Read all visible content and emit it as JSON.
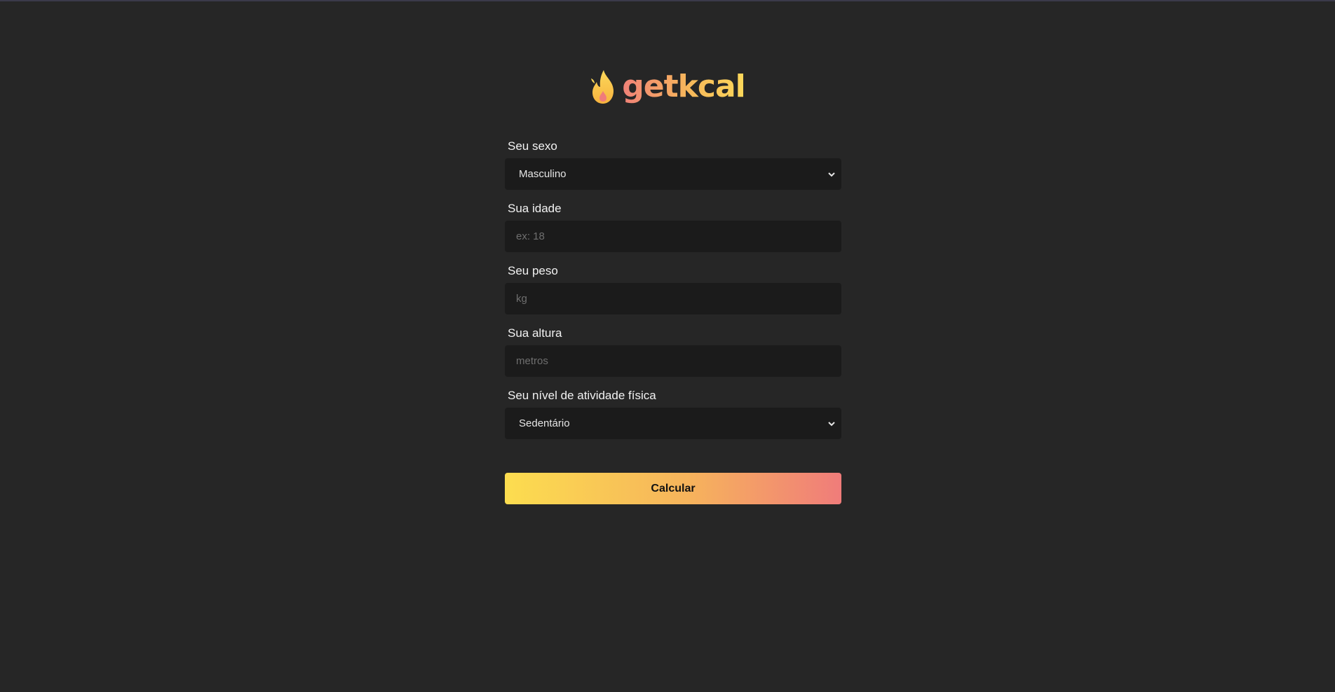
{
  "brand": {
    "name": "getkcal",
    "icon": "flame-icon",
    "gradient": [
      "#f08178",
      "#f7b85a",
      "#fcd85a"
    ]
  },
  "form": {
    "sex": {
      "label": "Seu sexo",
      "value": "Masculino"
    },
    "age": {
      "label": "Sua idade",
      "placeholder": "ex: 18"
    },
    "weight": {
      "label": "Seu peso",
      "placeholder": "kg"
    },
    "height": {
      "label": "Sua altura",
      "placeholder": "metros"
    },
    "activity": {
      "label": "Seu nível de atividade física",
      "value": "Sedentário"
    }
  },
  "submit": {
    "label": "Calcular"
  },
  "colors": {
    "background": "#262626",
    "field_background": "#1b1b1b",
    "button_gradient": [
      "#fcdd4f",
      "#f6b35c",
      "#f07c7a"
    ]
  }
}
